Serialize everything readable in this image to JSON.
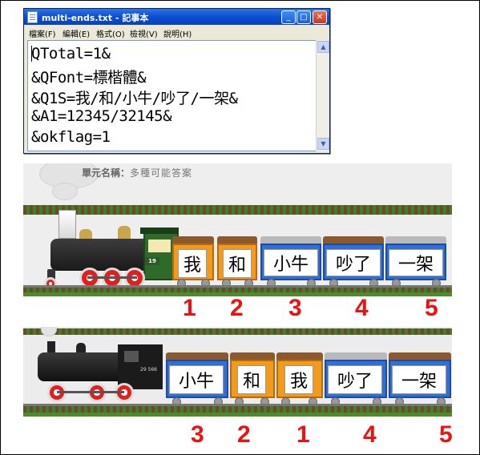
{
  "notepad": {
    "title": "multi-ends.txt - 記事本",
    "menu": [
      "檔案(F)",
      "編輯(E)",
      "格式(O)",
      "檢視(V)",
      "說明(H)"
    ],
    "lines": [
      "QTotal=1&",
      "&QFont=標楷體&",
      "&Q1S=我/和/小牛/吵了/一架&",
      "&A1=12345/32145&",
      "&okflag=1"
    ]
  },
  "scene1": {
    "unit_label": "單元名稱：",
    "unit_value": "多種可能答案",
    "loco_number": "19",
    "cards": [
      "我",
      "和",
      "小牛",
      "吵了",
      "一架"
    ],
    "numbers": [
      "1",
      "2",
      "3",
      "4",
      "5"
    ]
  },
  "scene2": {
    "loco_number": "29 566",
    "cards": [
      "小牛",
      "和",
      "我",
      "吵了",
      "一架"
    ],
    "numbers": [
      "3",
      "2",
      "1",
      "4",
      "5"
    ]
  },
  "colors": {
    "answer_number": "#ee1111",
    "title_bar": "#0a4fd0"
  }
}
